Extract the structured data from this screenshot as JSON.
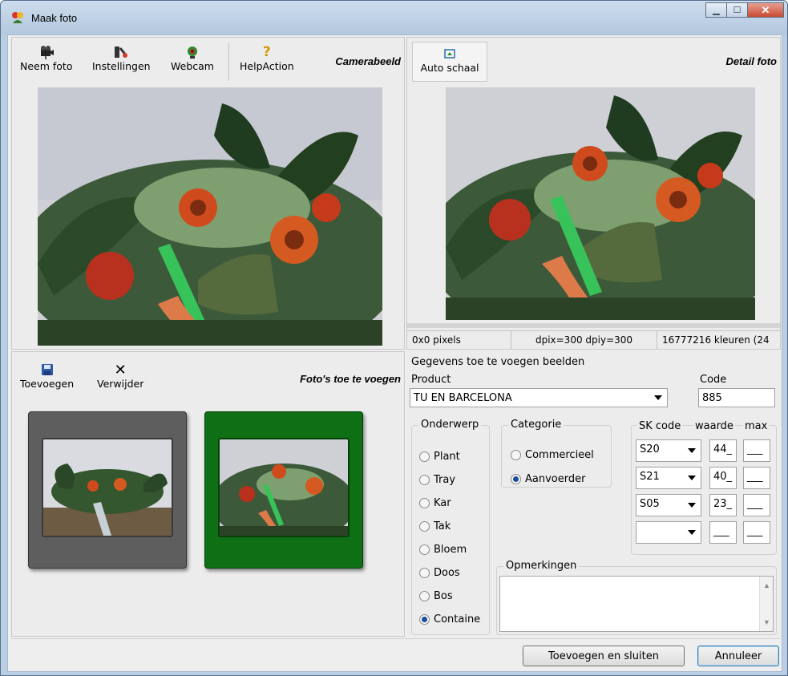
{
  "window": {
    "title": "Maak foto"
  },
  "camera_panel": {
    "title": "Camerabeeld",
    "buttons": [
      {
        "label": "Neem foto",
        "icon": "camera-icon"
      },
      {
        "label": "Instellingen",
        "icon": "settings-icon"
      },
      {
        "label": "Webcam",
        "icon": "webcam-icon"
      },
      {
        "label": "HelpAction",
        "icon": "help-icon"
      }
    ]
  },
  "detail_panel": {
    "title": "Detail foto",
    "auto_scale_label": "Auto schaal",
    "status": {
      "size": "0x0 pixels",
      "dpi": "dpix=300 dpiy=300",
      "colors": "16777216 kleuren (24"
    }
  },
  "photos_panel": {
    "title": "Foto's toe te voegen",
    "add_label": "Toevoegen",
    "remove_label": "Verwijder"
  },
  "form": {
    "group_title": "Gegevens toe te voegen beelden",
    "product_label": "Product",
    "product_value": "TU EN BARCELONA",
    "code_label": "Code",
    "code_value": "885",
    "onderwerp": {
      "title": "Onderwerp",
      "options": [
        "Plant",
        "Tray",
        "Kar",
        "Tak",
        "Bloem",
        "Doos",
        "Bos",
        "Containe"
      ],
      "selected": "Containe"
    },
    "categorie": {
      "title": "Categorie",
      "options": [
        "Commercieel",
        "Aanvoerder"
      ],
      "selected": "Aanvoerder"
    },
    "sk": {
      "headers": [
        "SK code",
        "waarde",
        "max"
      ],
      "rows": [
        {
          "code": "S20",
          "waarde": "44_",
          "max": "___"
        },
        {
          "code": "S21",
          "waarde": "40_",
          "max": "___"
        },
        {
          "code": "S05",
          "waarde": "23_",
          "max": "___"
        },
        {
          "code": "",
          "waarde": "___",
          "max": "___"
        }
      ]
    },
    "opmerkingen_label": "Opmerkingen"
  },
  "footer": {
    "ok_label": "Toevoegen en sluiten",
    "cancel_label": "Annuleer"
  },
  "colors": {
    "thumb1": "#5e5e5e",
    "thumb2": "#0f6f15",
    "title_bar": "#b9cde3"
  }
}
